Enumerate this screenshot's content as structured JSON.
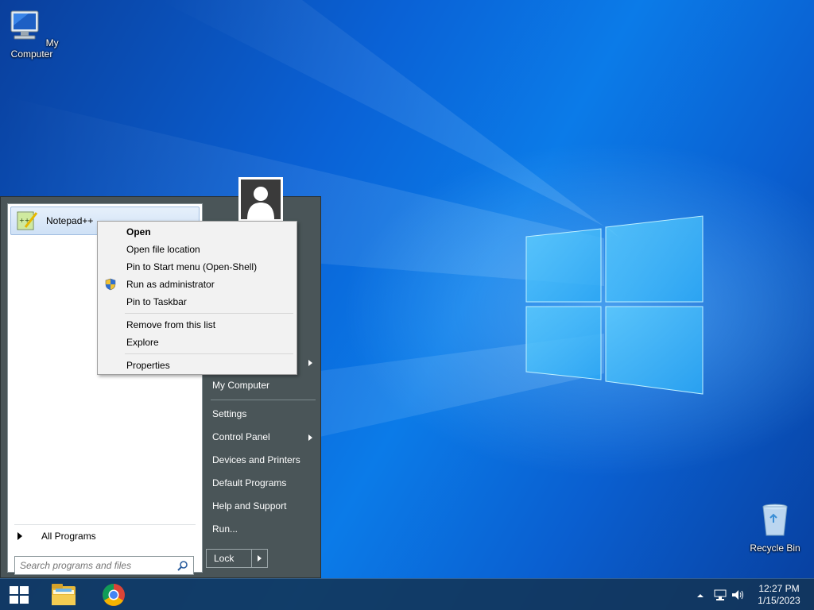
{
  "desktop": {
    "icons": [
      {
        "label": "My Computer",
        "icon": "computer-icon"
      },
      {
        "label": "Recycle Bin",
        "icon": "recycle-bin-icon"
      }
    ]
  },
  "start_menu": {
    "pinned_item": {
      "label": "Notepad++",
      "icon": "notepadpp-icon"
    },
    "all_programs_label": "All Programs",
    "search": {
      "placeholder": "Search programs and files"
    },
    "right_items": [
      {
        "label": "My Computer",
        "submenu": false
      },
      {
        "label": "Settings",
        "submenu": false
      },
      {
        "label": "Control Panel",
        "submenu": true
      },
      {
        "label": "Devices and Printers",
        "submenu": false
      },
      {
        "label": "Default Programs",
        "submenu": false
      },
      {
        "label": "Help and Support",
        "submenu": false
      },
      {
        "label": "Run...",
        "submenu": false
      }
    ],
    "lock_label": "Lock"
  },
  "context_menu": {
    "items": [
      {
        "label": "Open",
        "bold": true
      },
      {
        "label": "Open file location"
      },
      {
        "label": "Pin to Start menu (Open-Shell)"
      },
      {
        "label": "Run as administrator",
        "icon": "uac-shield-icon"
      },
      {
        "label": "Pin to Taskbar"
      },
      {
        "label": "Remove from this list"
      },
      {
        "label": "Explore"
      },
      {
        "label": "Properties"
      }
    ]
  },
  "taskbar": {
    "apps": [
      "file-explorer-icon",
      "chrome-icon"
    ],
    "clock": {
      "time": "12:27 PM",
      "date": "1/15/2023"
    }
  },
  "colors": {
    "start_menu_bg": "#4a5558",
    "desktop_blue": "#0a62d6",
    "taskbar_bg": "#123456"
  }
}
